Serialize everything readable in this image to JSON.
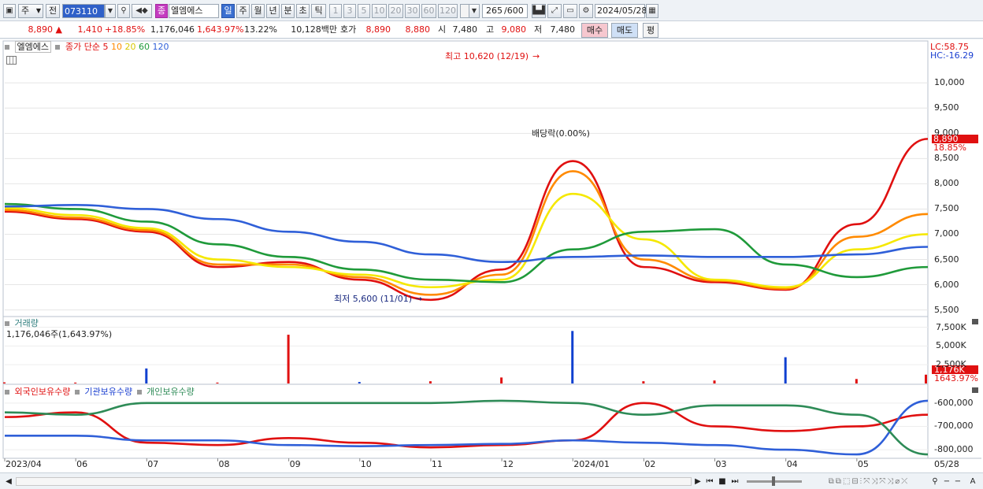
{
  "toolbar": {
    "period_select": "주",
    "prev_label": "전",
    "code_value": "073110",
    "stock_badge": "종",
    "stock_name": "엘엠에스",
    "periods": [
      "일",
      "주",
      "월",
      "년",
      "분",
      "초",
      "틱"
    ],
    "active_period": "일",
    "intervals": [
      "1",
      "3",
      "5",
      "10",
      "20",
      "30",
      "60",
      "120"
    ],
    "count": "265",
    "count_total": "/600",
    "date": "2024/05/28"
  },
  "quote": {
    "price": "8,890",
    "arrow": "▲",
    "change": "1,410",
    "change_pct": "+18.85%",
    "volume": "1,176,046",
    "volume_pct": "1,643.97%",
    "turnover_pct": "13.22%",
    "amount": "10,128백만",
    "hoga_label": "호가",
    "hoga_ask": "8,890",
    "hoga_bid": "8,880",
    "open_label": "시",
    "open": "7,480",
    "high_label": "고",
    "high": "9,080",
    "low_label": "저",
    "low": "7,480",
    "buy_label": "매수",
    "sell_label": "매도",
    "flat_label": "평"
  },
  "price_panel": {
    "stock_name": "엘엠에스",
    "ma_prefix": "종가 단순",
    "ma_labels": [
      "5",
      "10",
      "20",
      "60",
      "120"
    ],
    "lc": "LC:58.75",
    "hc": "HC:-16.29",
    "price_tag": "8,890",
    "price_tag_pct": "18.85%",
    "high_annot": "최고 10,620 (12/19)",
    "low_annot": "최저 5,600 (11/01)",
    "dividend_annot": "배당락(0.00%)",
    "y_ticks": [
      "10,000",
      "9,500",
      "9,000",
      "8,500",
      "8,000",
      "7,500",
      "7,000",
      "6,500",
      "6,000",
      "5,500"
    ]
  },
  "volume_panel": {
    "title": "거래량",
    "value_label": "1,176,046주(1,643.97%)",
    "y_ticks": [
      "7,500K",
      "5,000K",
      "2,500K"
    ],
    "tag": "1,176K",
    "tag_pct": "1643.97%"
  },
  "holding_panel": {
    "series": [
      "외국인보유수량",
      "기관보유수량",
      "개인보유수량"
    ],
    "y_ticks": [
      "-600,000",
      "-700,000",
      "-800,000"
    ]
  },
  "x_axis": {
    "labels": [
      "2023/04",
      "06",
      "07",
      "08",
      "09",
      "10",
      "11",
      "12",
      "2024/01",
      "02",
      "03",
      "04",
      "05",
      "05/28"
    ]
  },
  "colors": {
    "up": "#e01010",
    "down": "#1040d0",
    "ma5": "#e01010",
    "ma10": "#ff8a00",
    "ma20": "#f5e800",
    "ma60": "#1f9a3a",
    "ma120": "#2f5fd8",
    "foreign": "#e01010",
    "institution": "#2f5fd8",
    "individual": "#2e8b57"
  },
  "chart_data": [
    {
      "type": "line",
      "title": "",
      "ylabel": "",
      "ylim": [
        5400,
        10800
      ],
      "x": [
        "2023/04",
        "06",
        "07",
        "08",
        "09",
        "10",
        "11",
        "12",
        "2024/01",
        "02",
        "03",
        "04",
        "05",
        "05/28"
      ],
      "series": [
        {
          "name": "5",
          "values": [
            7450,
            7300,
            7050,
            6350,
            6450,
            6100,
            5700,
            6300,
            8450,
            6350,
            6050,
            5900,
            7200,
            8890
          ]
        },
        {
          "name": "10",
          "values": [
            7480,
            7330,
            7080,
            6400,
            6400,
            6150,
            5800,
            6200,
            8250,
            6500,
            6080,
            5920,
            6950,
            7400
          ]
        },
        {
          "name": "20",
          "values": [
            7520,
            7380,
            7120,
            6500,
            6350,
            6200,
            5950,
            6100,
            7800,
            6900,
            6100,
            5950,
            6700,
            7000
          ]
        },
        {
          "name": "60",
          "values": [
            7600,
            7500,
            7250,
            6800,
            6550,
            6300,
            6100,
            6050,
            6700,
            7050,
            7100,
            6400,
            6150,
            6350
          ]
        },
        {
          "name": "120",
          "values": [
            7550,
            7580,
            7500,
            7300,
            7050,
            6850,
            6600,
            6450,
            6550,
            6580,
            6550,
            6550,
            6600,
            6750
          ]
        }
      ]
    },
    {
      "type": "bar",
      "title": "거래량",
      "ylim": [
        0,
        8500
      ],
      "categories": [
        "2023/04",
        "06",
        "07",
        "08",
        "09",
        "10",
        "11",
        "12",
        "2024/01",
        "02",
        "03",
        "04",
        "05",
        "05/28"
      ],
      "values": [
        150,
        120,
        2000,
        120,
        6500,
        200,
        300,
        800,
        7000,
        300,
        400,
        3500,
        600,
        1176
      ]
    },
    {
      "type": "line",
      "ylim": [
        -830000,
        -560000
      ],
      "x": [
        "2023/04",
        "06",
        "07",
        "08",
        "09",
        "10",
        "11",
        "12",
        "2024/01",
        "02",
        "03",
        "04",
        "05",
        "05/28"
      ],
      "series": [
        {
          "name": "외국인보유수량",
          "values": [
            -660000,
            -640000,
            -770000,
            -780000,
            -750000,
            -770000,
            -790000,
            -780000,
            -760000,
            -600000,
            -700000,
            -720000,
            -700000,
            -650000
          ]
        },
        {
          "name": "기관보유수량",
          "values": [
            -740000,
            -740000,
            -760000,
            -760000,
            -780000,
            -785000,
            -780000,
            -775000,
            -760000,
            -770000,
            -780000,
            -800000,
            -820000,
            -590000
          ]
        },
        {
          "name": "개인보유수량",
          "values": [
            -640000,
            -650000,
            -600000,
            -600000,
            -600000,
            -600000,
            -600000,
            -590000,
            -600000,
            -650000,
            -610000,
            -610000,
            -650000,
            -820000
          ]
        }
      ]
    }
  ]
}
